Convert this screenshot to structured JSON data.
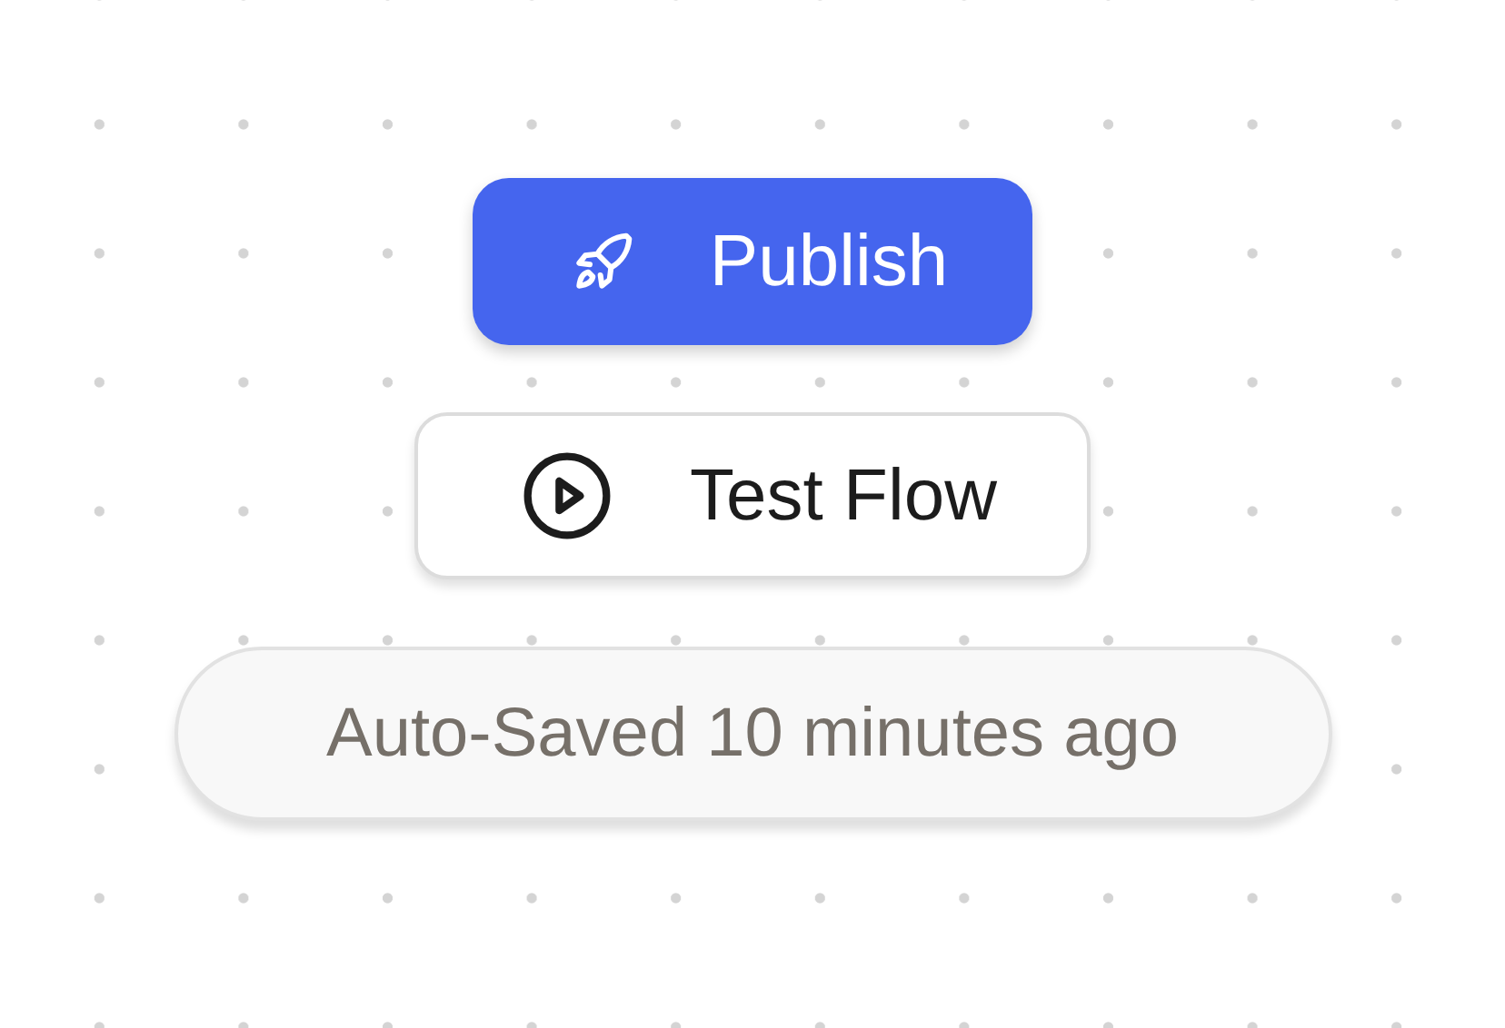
{
  "actions": [
    {
      "kind": "primary",
      "label": "Publish"
    },
    {
      "kind": "secondary",
      "label": "Test Flow"
    },
    {
      "kind": "status",
      "label": "Auto-Saved 10 minutes ago"
    }
  ]
}
